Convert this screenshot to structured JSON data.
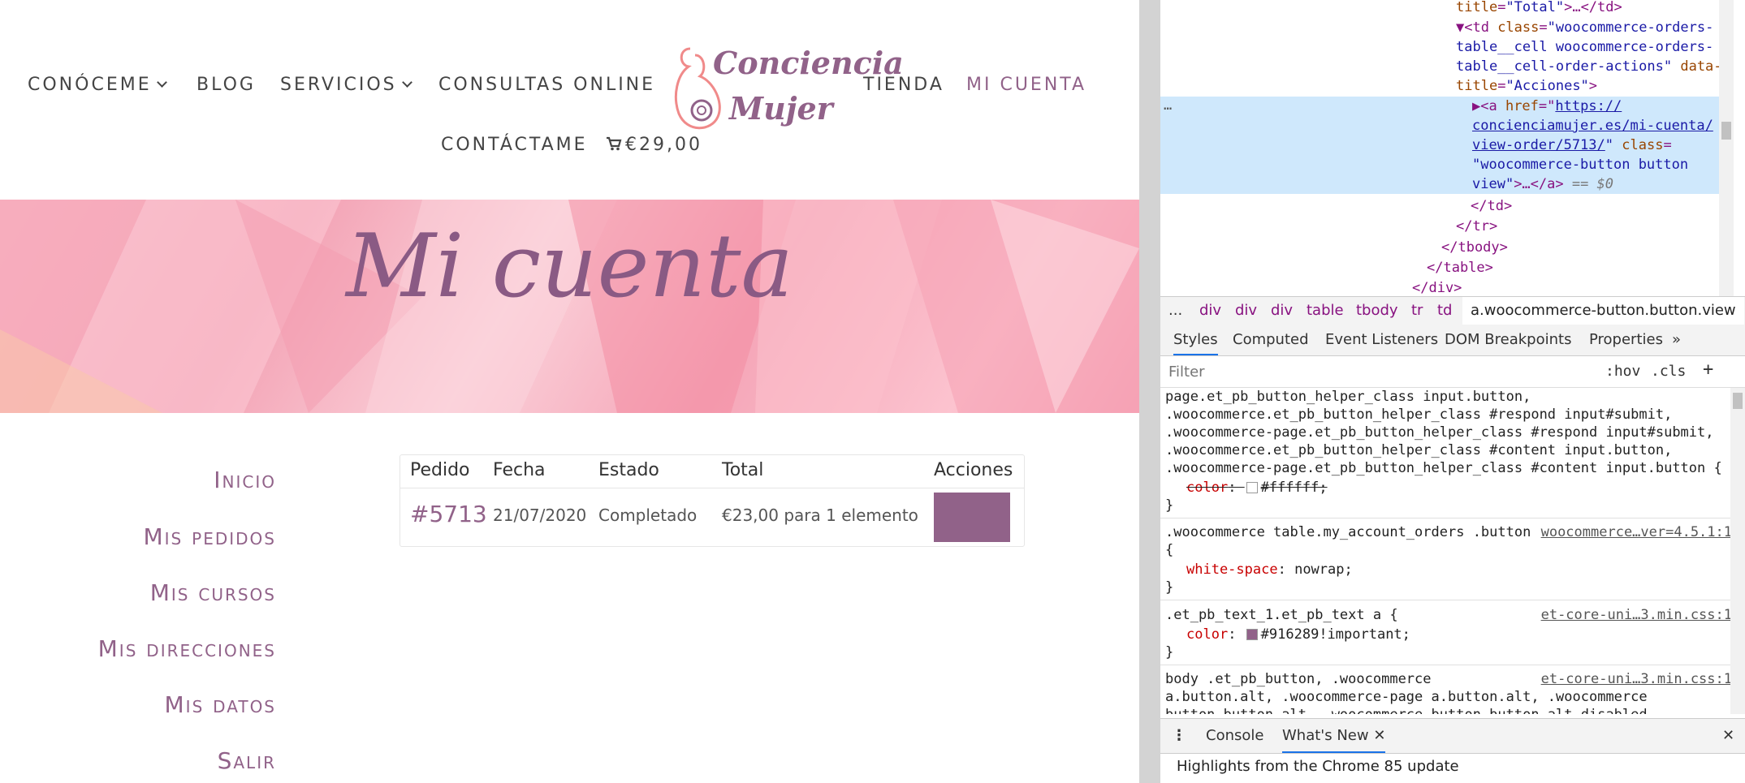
{
  "site": {
    "nav": {
      "conoceme": "CONÓCEME",
      "blog": "BLOG",
      "servicios": "SERVICIOS",
      "consultas": "CONSULTAS ONLINE",
      "tienda": "TIENDA",
      "mi_cuenta": "MI CUENTA",
      "contactame": "CONTÁCTAME",
      "cart_total": "€29,00"
    },
    "logo_line1": "Conciencia",
    "logo_line2": "Mujer",
    "banner_title": "Mi cuenta",
    "sidebar": [
      "Inicio",
      "Mis pedidos",
      "Mis cursos",
      "Mis direcciones",
      "Mis datos",
      "Salir"
    ],
    "orders_table": {
      "headers": [
        "Pedido",
        "Fecha",
        "Estado",
        "Total",
        "Acciones"
      ],
      "rows": [
        {
          "order": "#5713",
          "date": "21/07/2020",
          "status": "Completado",
          "total": "€23,00 para 1 elemento"
        }
      ]
    },
    "colors": {
      "accent": "#916289",
      "text": "#444444"
    }
  },
  "devtools": {
    "elements": {
      "l1_attr": "title",
      "l1_val": "\"Total\"",
      "l1_rest": ">…</td>",
      "l2_tag": "▼<td ",
      "l2_attr": "class",
      "l2_val": "\"woocommerce-orders-",
      "l3_val": "table__cell woocommerce-orders-",
      "l4_val": "table__cell-order-actions\"",
      "l4_attr": " data-",
      "l5_attr": "title",
      "l5_val": "\"Acciones\"",
      "l5_rest": ">",
      "dots": "…",
      "s1_tag": "▶<a ",
      "s1_attr": "href",
      "s1_val": "https://",
      "s2_val": "concienciamujer.es/mi-cuenta/",
      "s3_val": "view-order/5713/",
      "s3_attr": " class",
      "s4_val": "\"woocommerce-button button",
      "s5_val": "view\"",
      "s5_rest": ">…</a>",
      "s5_eq": " == $0",
      "c1": "</td>",
      "c2": "</tr>",
      "c3": "</tbody>",
      "c4": "</table>",
      "c5": "</div>"
    },
    "breadcrumbs": [
      "...",
      "div",
      "div",
      "div",
      "table",
      "tbody",
      "tr",
      "td",
      "a.woocommerce-button.button.view"
    ],
    "subtabs": [
      "Styles",
      "Computed",
      "Event Listeners",
      "DOM Breakpoints",
      "Properties",
      "»"
    ],
    "filter_placeholder": "Filter",
    "hov": ":hov",
    "cls": ".cls",
    "plus": "+",
    "styles": {
      "r1_l1": "page.et_pb_button_helper_class input.button,",
      "r1_l2": ".woocommerce.et_pb_button_helper_class #respond input#submit,",
      "r1_l3": ".woocommerce-page.et_pb_button_helper_class #respond input#submit,",
      "r1_l4": ".woocommerce.et_pb_button_helper_class #content input.button,",
      "r1_l5": ".woocommerce-page.et_pb_button_helper_class #content input.button {",
      "r1_prop": "color",
      "r1_val": "#ffffff;",
      "close": "}",
      "r2_sel": ".woocommerce table.my_account_orders .button",
      "r2_src": "woocommerce…ver=4.5.1:1",
      "r2_open": "{",
      "r2_prop": "white-space",
      "r2_val": "nowrap;",
      "r3_sel": ".et_pb_text_1.et_pb_text a {",
      "r3_src": "et-core-uni…3.min.css:1",
      "r3_prop": "color",
      "r3_val": "#916289!important;",
      "r4_l1": "body .et_pb_button, .woocommerce",
      "r4_l2": "a.button.alt, .woocommerce-page a.button.alt, .woocommerce",
      "r4_l3": "button.button.alt, .woocommerce button.button.alt.disabled,",
      "r4_src": "et-core-uni…3.min.css:1",
      "r4_src2": ".woocommerce"
    },
    "drawer": {
      "tabs": [
        "Console",
        "What's New"
      ],
      "close_tab": "✕",
      "content": "Highlights from the Chrome 85 update",
      "close": "✕"
    }
  }
}
